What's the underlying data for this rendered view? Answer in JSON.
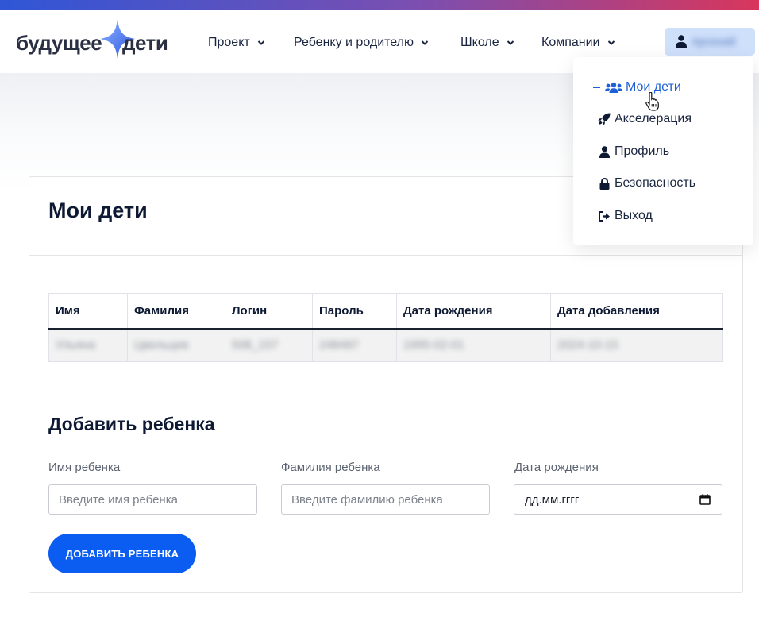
{
  "logo": {
    "word1": "будущее",
    "word2": "дети"
  },
  "nav": [
    {
      "label": "Проект"
    },
    {
      "label": "Ребенку и родителю"
    },
    {
      "label": "Школе"
    },
    {
      "label": "Компании"
    }
  ],
  "user": {
    "name": "Арсений"
  },
  "dropdown": {
    "items": [
      {
        "label": "Мои дети",
        "icon": "users-icon",
        "active": true
      },
      {
        "label": "Акселерация",
        "icon": "rocket-icon"
      },
      {
        "label": "Профиль",
        "icon": "user-icon"
      },
      {
        "label": "Безопасность",
        "icon": "lock-icon"
      },
      {
        "label": "Выход",
        "icon": "sign-out-icon"
      }
    ]
  },
  "page": {
    "title": "Мои дети"
  },
  "table": {
    "headers": [
      "Имя",
      "Фамилия",
      "Логин",
      "Пароль",
      "Дата рождения",
      "Дата добавления"
    ],
    "rows": [
      [
        "Ульяна",
        "Цвельцев",
        "508_157",
        "248487",
        "1995-02-01",
        "2024-10-15"
      ]
    ]
  },
  "form": {
    "title": "Добавить ребенка",
    "first_name": {
      "label": "Имя ребенка",
      "placeholder": "Введите имя ребенка"
    },
    "last_name": {
      "label": "Фамилия ребенка",
      "placeholder": "Введите фамилию ребенка"
    },
    "birth_date": {
      "label": "Дата рождения",
      "placeholder": "дд.мм.гггг"
    },
    "submit_label": "ДОБАВИТЬ РЕБЕНКА"
  },
  "colors": {
    "accent": "#0b5cf0",
    "active_link": "#1f5fd6",
    "text": "#0e1a33",
    "user_button_bg": "#cfe0fb"
  }
}
